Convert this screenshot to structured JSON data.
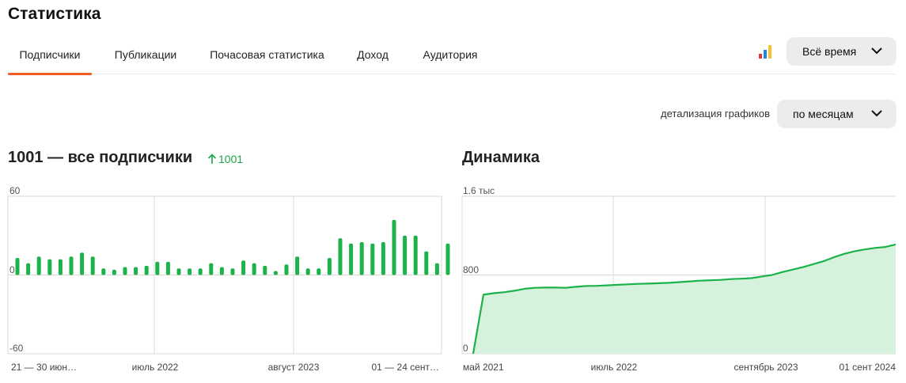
{
  "page": {
    "title": "Статистика"
  },
  "tabs": [
    {
      "label": "Подписчики",
      "active": true
    },
    {
      "label": "Публикации",
      "active": false
    },
    {
      "label": "Почасовая статистика",
      "active": false
    },
    {
      "label": "Доход",
      "active": false
    },
    {
      "label": "Аудитория",
      "active": false
    }
  ],
  "period_select": {
    "value": "Всё время",
    "icon": "chevron-down-icon"
  },
  "grade_icon": {
    "name": "colored-bars-icon",
    "colors": [
      "#e53935",
      "#1e88e5",
      "#fbc02d"
    ]
  },
  "detail": {
    "label": "детализация графиков",
    "value": "по месяцам"
  },
  "subscribers": {
    "heading": "1001 — все подписчики",
    "growth": "1001",
    "growth_color": "#19a44a"
  },
  "dynamics": {
    "heading": "Динамика"
  },
  "chart_data": [
    {
      "type": "bar",
      "ylim": [
        -60,
        60
      ],
      "y_ticks": [
        "60",
        "0",
        "-60"
      ],
      "x_labels": [
        "21 — 30 июн…",
        "июль 2022",
        "август 2023",
        "01 — 24 сент…"
      ],
      "colors": {
        "positive": "#1cb24a",
        "negative": "#cccccc"
      },
      "series": [
        {
          "values": [
            13,
            9,
            14,
            12,
            12,
            14,
            17,
            14,
            5,
            4,
            6,
            6,
            7,
            10,
            10,
            5,
            5,
            5,
            9,
            6,
            5,
            11,
            9,
            7,
            3,
            8,
            14,
            5,
            5,
            13,
            28,
            24,
            25,
            24,
            25,
            42,
            30,
            30,
            18,
            9,
            24,
            19
          ]
        },
        {
          "values": [
            -2,
            -2,
            -3,
            -2,
            -2,
            -1,
            -2,
            -4,
            -1,
            -2,
            -7,
            -2,
            -1,
            -2,
            -3,
            -1,
            -1,
            -1,
            -1,
            -2,
            -1,
            -2,
            -2,
            -1,
            -1,
            -1,
            -1,
            -1,
            -1,
            -1,
            -2,
            -1,
            -2,
            -1,
            -3,
            -4,
            -2,
            -1,
            -2,
            -1,
            -1,
            -2
          ]
        }
      ]
    },
    {
      "type": "area",
      "ylim": [
        0,
        1600
      ],
      "y_ticks": [
        "1.6 тыс",
        "800",
        "0"
      ],
      "x_labels": [
        "май 2021",
        "июль 2022",
        "сентябрь 2023",
        "01 сент 2024"
      ],
      "colors": {
        "line": "#1cb24a",
        "fill": "#d6f2dd"
      },
      "values": [
        0,
        600,
        615,
        625,
        640,
        660,
        670,
        672,
        672,
        670,
        680,
        688,
        690,
        695,
        700,
        705,
        710,
        712,
        716,
        720,
        728,
        735,
        742,
        746,
        750,
        758,
        762,
        768,
        785,
        800,
        830,
        855,
        880,
        910,
        940,
        980,
        1015,
        1040,
        1060,
        1075,
        1085,
        1110
      ]
    }
  ]
}
